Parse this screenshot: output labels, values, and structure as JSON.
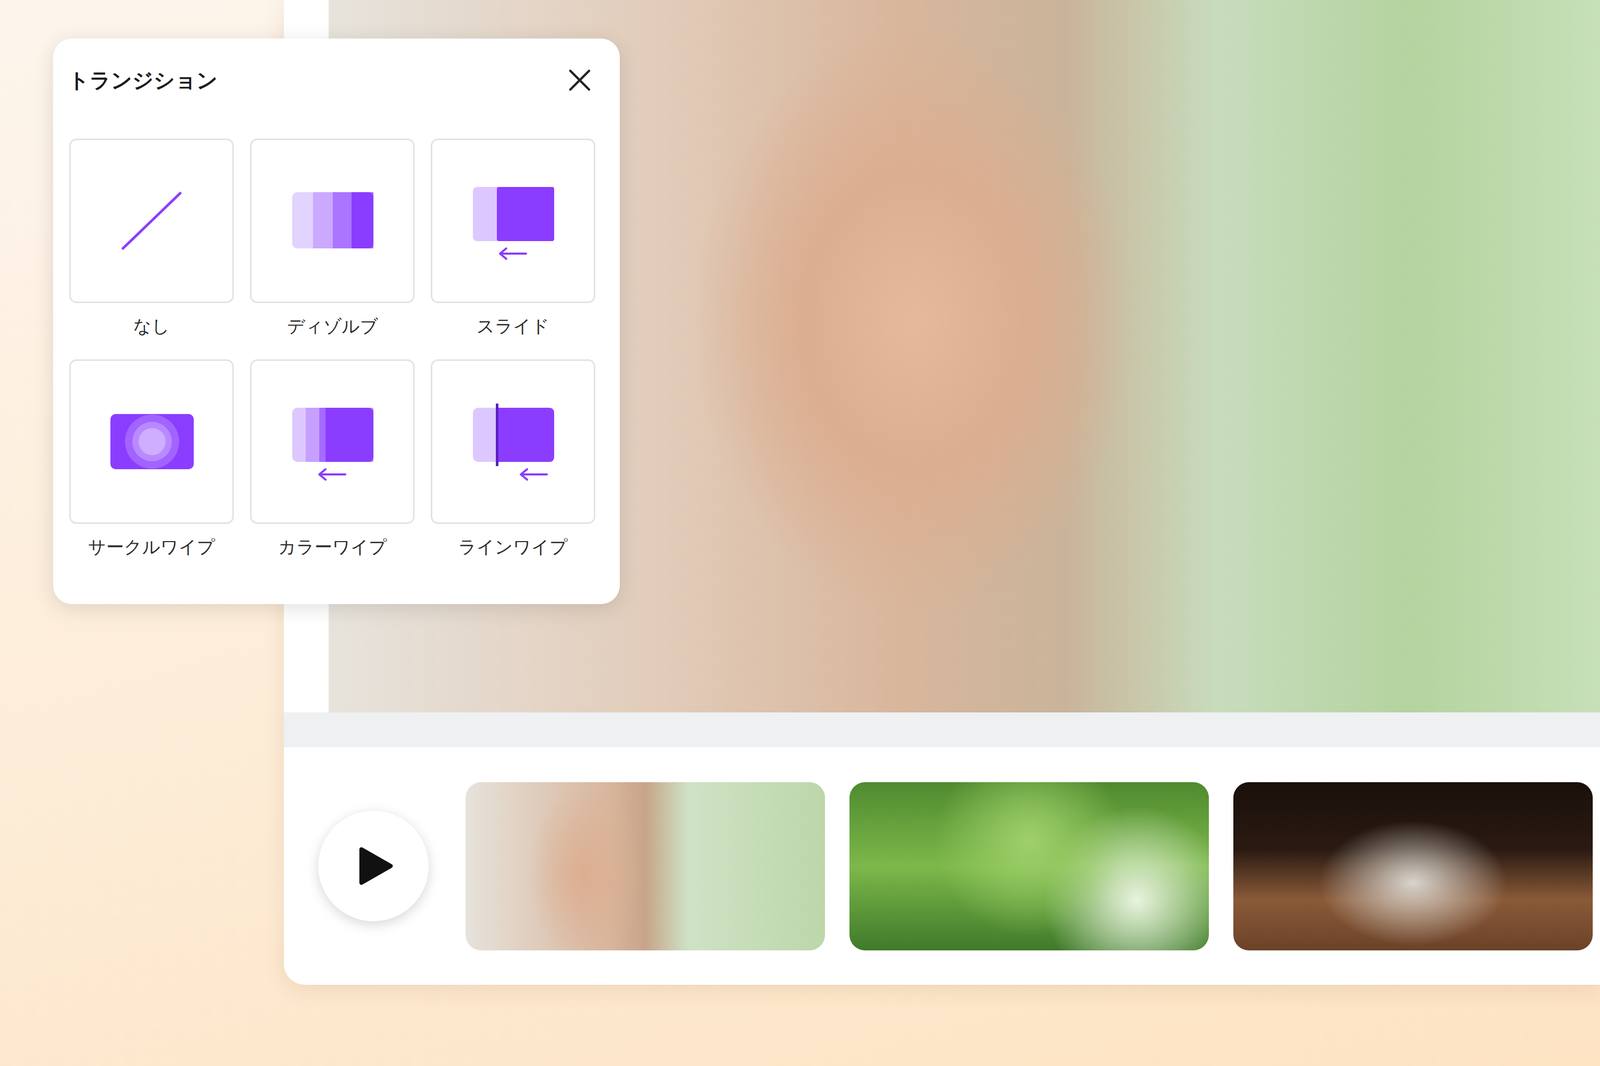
{
  "panel": {
    "title": "トランジション"
  },
  "transitions": [
    {
      "label": "なし",
      "kind": "none"
    },
    {
      "label": "ディゾルブ",
      "kind": "dissolve"
    },
    {
      "label": "スライド",
      "kind": "slide"
    },
    {
      "label": "サークルワイプ",
      "kind": "circle"
    },
    {
      "label": "カラーワイプ",
      "kind": "colorwipe"
    },
    {
      "label": "ラインワイプ",
      "kind": "linewipe"
    }
  ],
  "playback": {
    "playing": false
  },
  "clips": [
    {
      "kind": "portrait"
    },
    {
      "kind": "leaves"
    },
    {
      "kind": "glass"
    }
  ]
}
